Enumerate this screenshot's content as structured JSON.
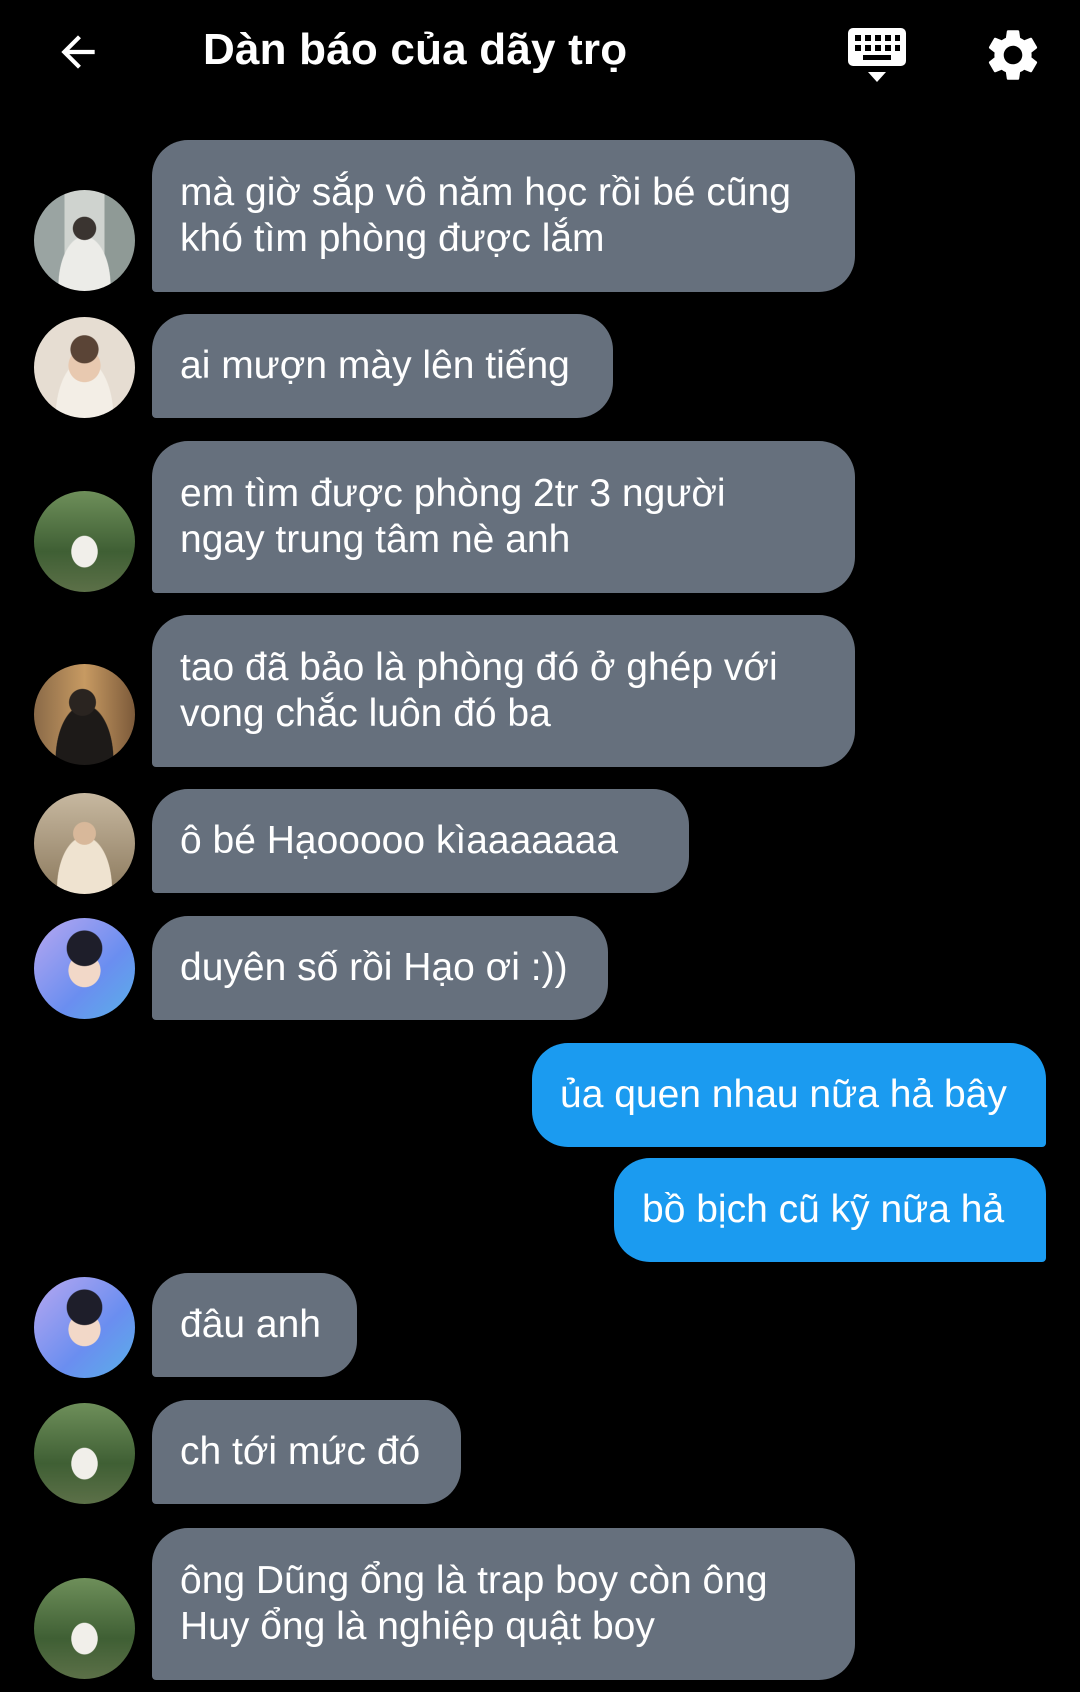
{
  "header": {
    "title": "Dàn báo của dãy trọ"
  },
  "icons": {
    "back": "arrow-left-icon",
    "keyboard": "keyboard-icon",
    "settings": "gear-icon"
  },
  "colors": {
    "background": "#000000",
    "incoming_bubble": "#66707d",
    "outgoing_bubble": "#1b9bf0",
    "text": "#ffffff"
  },
  "messages": [
    {
      "direction": "in",
      "lines": [
        "mà giờ sắp vô năm học rồi bé cũng",
        "khó tìm phòng được lắm"
      ]
    },
    {
      "direction": "in",
      "lines": [
        "ai mượn mày lên tiếng"
      ]
    },
    {
      "direction": "in",
      "lines": [
        "em tìm được phòng 2tr 3 người",
        "ngay trung tâm nè anh"
      ]
    },
    {
      "direction": "in",
      "lines": [
        "tao đã bảo là phòng đó ở ghép với",
        "vong chắc luôn đó ba"
      ]
    },
    {
      "direction": "in",
      "lines": [
        "ô bé Hạooooo kìaaaaaaa"
      ]
    },
    {
      "direction": "in",
      "lines": [
        "duyên số rồi Hạo ơi :))"
      ]
    },
    {
      "direction": "out",
      "lines": [
        "ủa quen nhau nữa hả bây"
      ]
    },
    {
      "direction": "out",
      "lines": [
        "bồ bịch cũ kỹ nữa hả"
      ]
    },
    {
      "direction": "in",
      "lines": [
        "đâu anh"
      ]
    },
    {
      "direction": "in",
      "lines": [
        "ch tới mức đó"
      ]
    },
    {
      "direction": "in",
      "lines": [
        "ông Dũng ổng là trap boy còn ông",
        "Huy ổng là nghiệp quật boy"
      ]
    }
  ]
}
